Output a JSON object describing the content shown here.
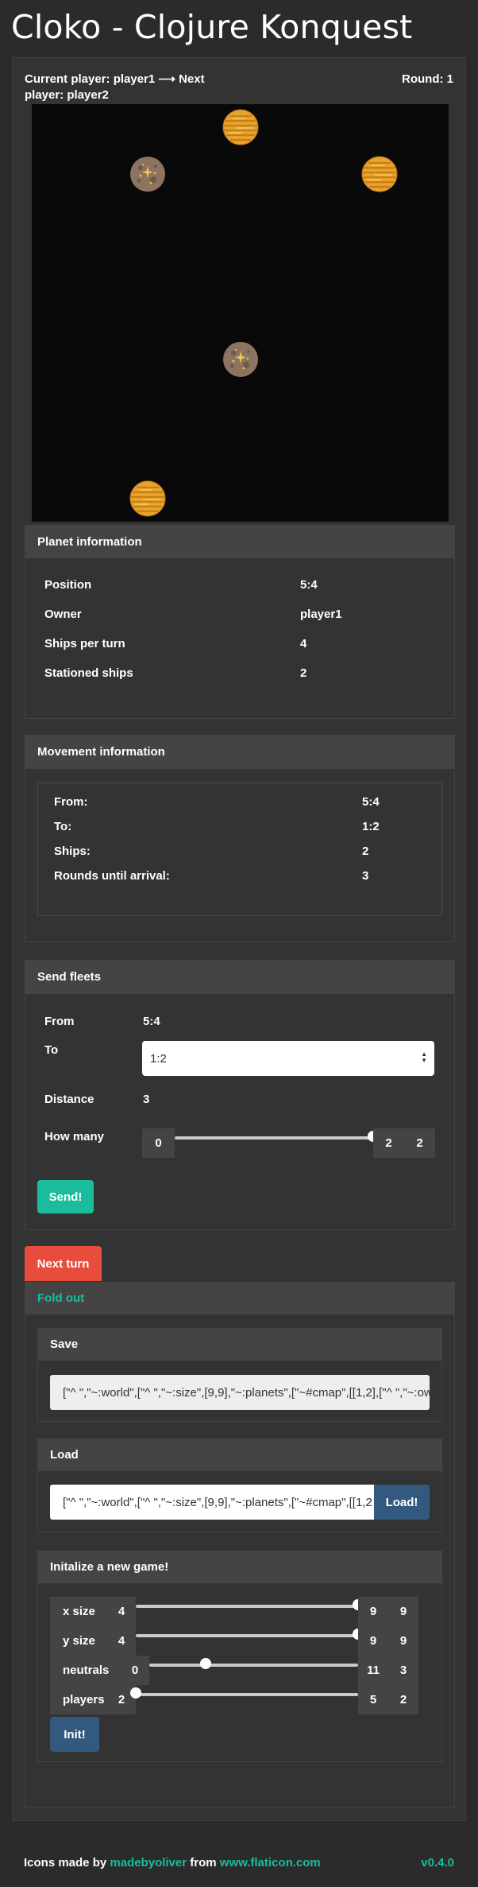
{
  "app": {
    "title": "Cloko - Clojure Konquest"
  },
  "status": {
    "current_player": "Current player: player1 ⟶ Next player: player2",
    "round": "Round: 1"
  },
  "map": {
    "planets": [
      {
        "col": 5,
        "row": 1,
        "kind": "golden",
        "icon": "golden-planet-icon"
      },
      {
        "col": 3,
        "row": 2,
        "kind": "neutral",
        "icon": "neutral-planet-icon"
      },
      {
        "col": 8,
        "row": 2,
        "kind": "golden",
        "icon": "golden-planet-icon"
      },
      {
        "col": 5,
        "row": 6,
        "kind": "neutral",
        "icon": "neutral-planet-icon"
      },
      {
        "col": 3,
        "row": 9,
        "kind": "golden",
        "icon": "golden-planet-icon"
      }
    ]
  },
  "planet_info": {
    "header": "Planet information",
    "rows": [
      {
        "label": "Position",
        "value": "5:4"
      },
      {
        "label": "Owner",
        "value": "player1"
      },
      {
        "label": "Ships per turn",
        "value": "4"
      },
      {
        "label": "Stationed ships",
        "value": "2"
      }
    ]
  },
  "movement_info": {
    "header": "Movement information",
    "rows": [
      {
        "label": "From:",
        "value": "5:4"
      },
      {
        "label": "To:",
        "value": "1:2"
      },
      {
        "label": "Ships:",
        "value": "2"
      },
      {
        "label": "Rounds until arrival:",
        "value": "3"
      }
    ]
  },
  "send_fleets": {
    "header": "Send fleets",
    "from_label": "From",
    "from_value": "5:4",
    "to_label": "To",
    "to_value": "1:2",
    "distance_label": "Distance",
    "distance_value": "3",
    "how_many_label": "How many",
    "how_many_min": "0",
    "how_many_max": "2",
    "how_many_value": "2",
    "how_many_level": 1.0,
    "send_label": "Send!"
  },
  "next_turn_label": "Next turn",
  "fold_out_label": "Fold out",
  "save": {
    "header": "Save",
    "value": "[\"^ \",\"~:world\",[\"^ \",\"~:size\",[9,9],\"~:planets\",[\"~#cmap\",[[1,2],[\"^ \",\"~:ow"
  },
  "load": {
    "header": "Load",
    "value": "[\"^ \",\"~:world\",[\"^ \",\"~:size\",[9,9],\"~:planets\",[\"~#cmap\",[[1,2",
    "button": "Load!"
  },
  "init": {
    "header": "Initalize a new game!",
    "sliders": [
      {
        "label": "x size",
        "min": "4",
        "max": "9",
        "value": "9",
        "level": 1.0
      },
      {
        "label": "y size",
        "min": "4",
        "max": "9",
        "value": "9",
        "level": 1.0
      },
      {
        "label": "neutrals",
        "min": "0",
        "max": "11",
        "value": "3",
        "level": 0.27
      },
      {
        "label": "players",
        "min": "2",
        "max": "5",
        "value": "2",
        "level": 0.0
      }
    ],
    "button": "Init!"
  },
  "footer": {
    "icons_made_by": "Icons made by",
    "author": "madebyoliver",
    "from": "from",
    "site": "www.flaticon.com",
    "version": "v0.4.0"
  },
  "colors": {
    "accent_green": "#1abc9c",
    "danger_red": "#e74c3c",
    "button_blue": "#34597f",
    "planet_gold": "#e7a32a",
    "planet_neutral": "#8c7460"
  }
}
